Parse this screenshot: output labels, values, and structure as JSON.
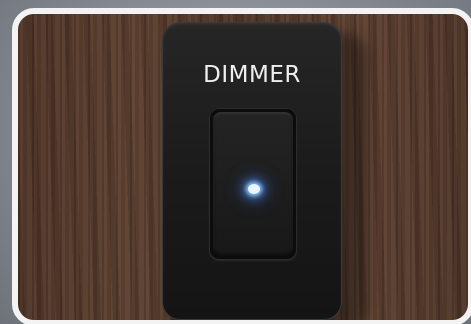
{
  "photo": {
    "switch_label": "DIMMER",
    "colors": {
      "wall": "#4d3428",
      "plate": "#1b1b1b",
      "label_text": "#efefef",
      "indicator_light": "#8fc8ff",
      "frame_border": "#f3f3f3"
    },
    "icons": [
      "blue-indicator-light-icon"
    ]
  }
}
